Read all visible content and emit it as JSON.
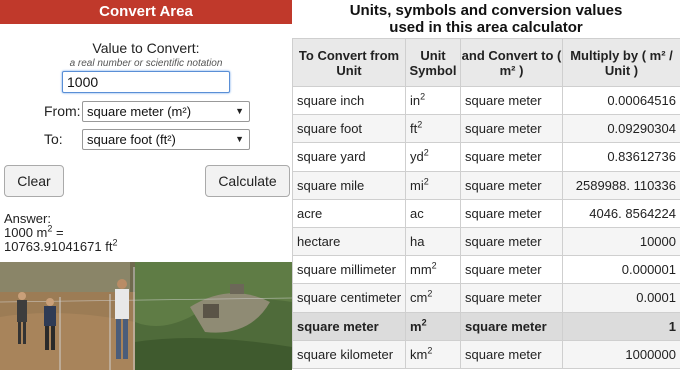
{
  "converter": {
    "title": "Convert Area",
    "value_label": "Value to Convert:",
    "value_hint": "a real number or scientific notation",
    "value": "1000",
    "from_label": "From:",
    "from_value": "square meter (m²)",
    "to_label": "To:",
    "to_value": "square foot (ft²)",
    "clear_label": "Clear",
    "calculate_label": "Calculate",
    "answer_label": "Answer:",
    "answer_input": "1000 m",
    "answer_input_exp": "2",
    "answer_eq": " =",
    "answer_result": "10763.91041671 ft",
    "answer_result_exp": "2"
  },
  "table": {
    "title_line1": "Units, symbols and conversion values",
    "title_line2": "used in this area calculator",
    "headers": [
      "To Convert from Unit",
      "Unit Symbol",
      "and Convert to ( m² )",
      "Multiply by ( m² / Unit )"
    ],
    "rows": [
      {
        "unit": "square inch",
        "sym": "in",
        "exp": "2",
        "to": "square meter",
        "factor": "0.00064516"
      },
      {
        "unit": "square foot",
        "sym": "ft",
        "exp": "2",
        "to": "square meter",
        "factor": "0.09290304"
      },
      {
        "unit": "square yard",
        "sym": "yd",
        "exp": "2",
        "to": "square meter",
        "factor": "0.83612736"
      },
      {
        "unit": "square mile",
        "sym": "mi",
        "exp": "2",
        "to": "square meter",
        "factor": "2589988. 110336"
      },
      {
        "unit": "acre",
        "sym": "ac",
        "exp": "",
        "to": "square meter",
        "factor": "4046. 8564224"
      },
      {
        "unit": "hectare",
        "sym": "ha",
        "exp": "",
        "to": "square meter",
        "factor": "10000"
      },
      {
        "unit": "square millimeter",
        "sym": "mm",
        "exp": "2",
        "to": "square meter",
        "factor": "0.000001"
      },
      {
        "unit": "square centimeter",
        "sym": "cm",
        "exp": "2",
        "to": "square meter",
        "factor": "0.0001"
      },
      {
        "unit": "square meter",
        "sym": "m",
        "exp": "2",
        "to": "square meter",
        "factor": "1"
      },
      {
        "unit": "square kilometer",
        "sym": "km",
        "exp": "2",
        "to": "square meter",
        "factor": "1000000"
      }
    ]
  },
  "colors": {
    "header_bar": "#c0392b",
    "input_border": "#5a8fd6"
  }
}
